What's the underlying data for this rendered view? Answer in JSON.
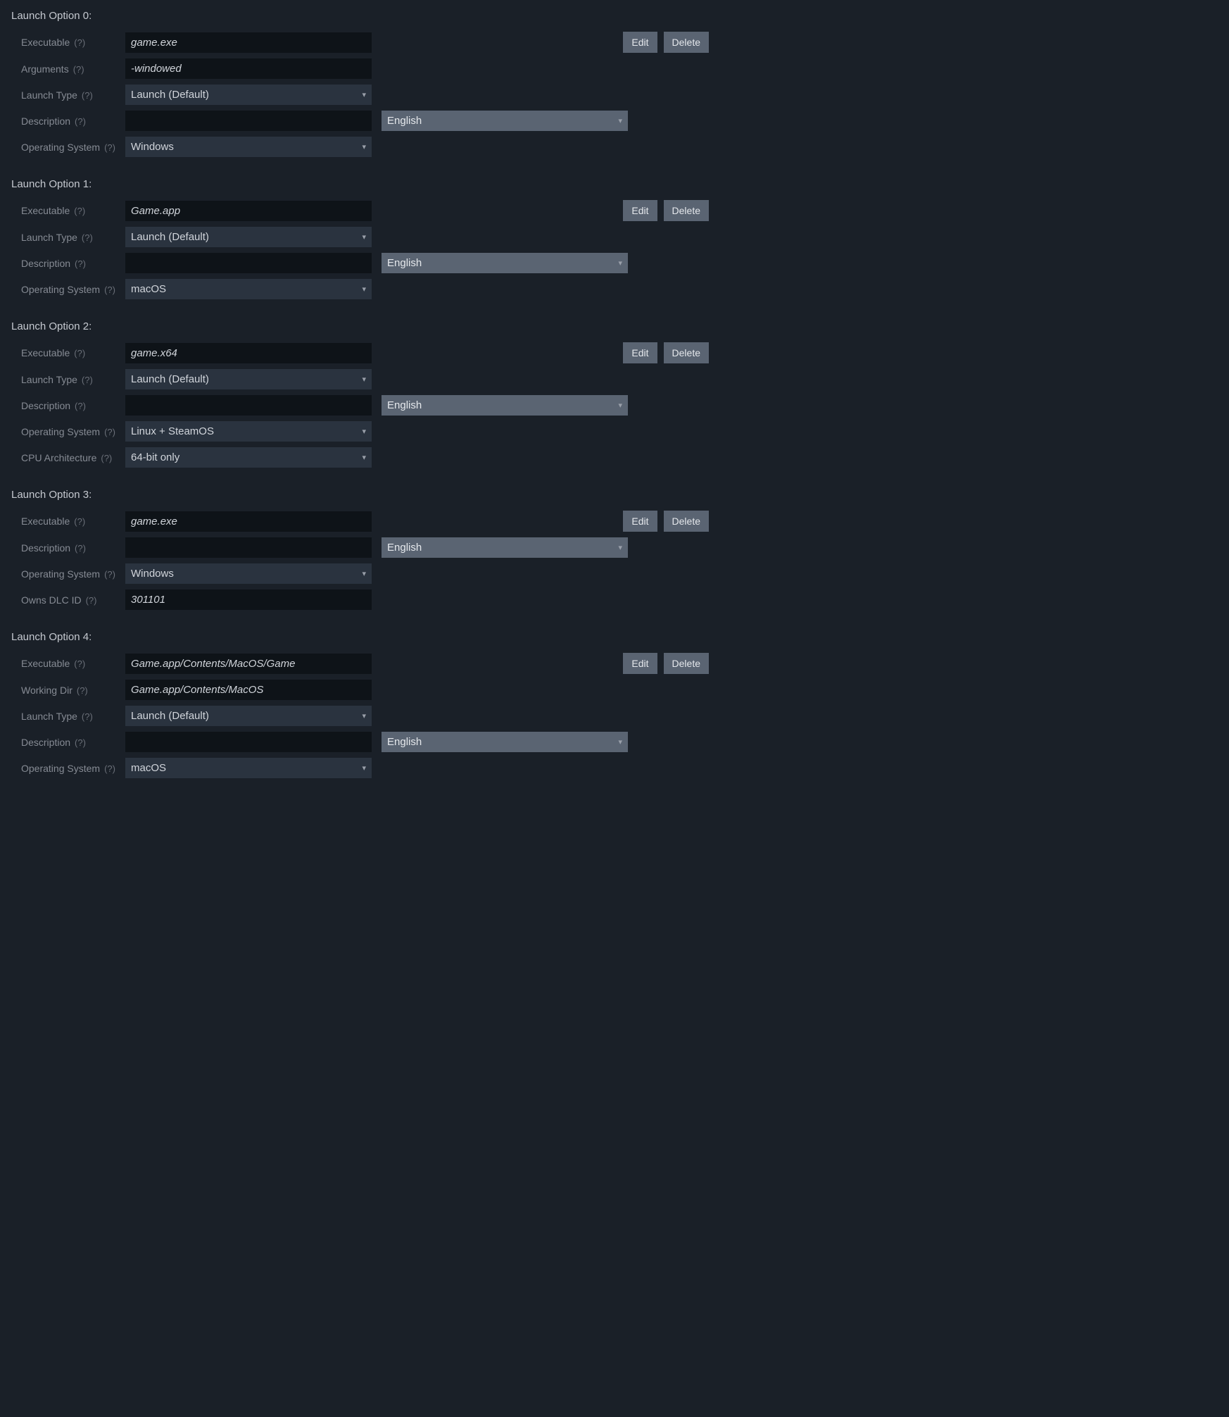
{
  "labels": {
    "executable": "Executable",
    "arguments": "Arguments",
    "launch_type": "Launch Type",
    "description": "Description",
    "operating_system": "Operating System",
    "cpu_architecture": "CPU Architecture",
    "owns_dlc_id": "Owns DLC ID",
    "working_dir": "Working Dir",
    "help": "(?)",
    "edit": "Edit",
    "delete": "Delete"
  },
  "options": [
    {
      "title": "Launch Option 0:",
      "rows": [
        {
          "type": "text",
          "label_key": "executable",
          "value": "game.exe",
          "buttons": true
        },
        {
          "type": "text",
          "label_key": "arguments",
          "value": "-windowed"
        },
        {
          "type": "select",
          "label_key": "launch_type",
          "value": "Launch (Default)"
        },
        {
          "type": "desc",
          "label_key": "description",
          "value": "",
          "lang": "English"
        },
        {
          "type": "select",
          "label_key": "operating_system",
          "value": "Windows"
        }
      ]
    },
    {
      "title": "Launch Option 1:",
      "rows": [
        {
          "type": "text",
          "label_key": "executable",
          "value": "Game.app",
          "buttons": true
        },
        {
          "type": "select",
          "label_key": "launch_type",
          "value": "Launch (Default)"
        },
        {
          "type": "desc",
          "label_key": "description",
          "value": "",
          "lang": "English"
        },
        {
          "type": "select",
          "label_key": "operating_system",
          "value": "macOS"
        }
      ]
    },
    {
      "title": "Launch Option 2:",
      "rows": [
        {
          "type": "text",
          "label_key": "executable",
          "value": "game.x64",
          "buttons": true
        },
        {
          "type": "select",
          "label_key": "launch_type",
          "value": "Launch (Default)"
        },
        {
          "type": "desc",
          "label_key": "description",
          "value": "",
          "lang": "English"
        },
        {
          "type": "select",
          "label_key": "operating_system",
          "value": "Linux + SteamOS"
        },
        {
          "type": "select",
          "label_key": "cpu_architecture",
          "value": "64-bit only"
        }
      ]
    },
    {
      "title": "Launch Option 3:",
      "rows": [
        {
          "type": "text",
          "label_key": "executable",
          "value": "game.exe",
          "buttons": true
        },
        {
          "type": "desc",
          "label_key": "description",
          "value": "",
          "lang": "English"
        },
        {
          "type": "select",
          "label_key": "operating_system",
          "value": "Windows"
        },
        {
          "type": "text",
          "label_key": "owns_dlc_id",
          "value": "301101"
        }
      ]
    },
    {
      "title": "Launch Option 4:",
      "rows": [
        {
          "type": "text",
          "label_key": "executable",
          "value": "Game.app/Contents/MacOS/Game",
          "buttons": true
        },
        {
          "type": "text",
          "label_key": "working_dir",
          "value": "Game.app/Contents/MacOS"
        },
        {
          "type": "select",
          "label_key": "launch_type",
          "value": "Launch (Default)"
        },
        {
          "type": "desc",
          "label_key": "description",
          "value": "",
          "lang": "English"
        },
        {
          "type": "select",
          "label_key": "operating_system",
          "value": "macOS"
        }
      ]
    }
  ]
}
